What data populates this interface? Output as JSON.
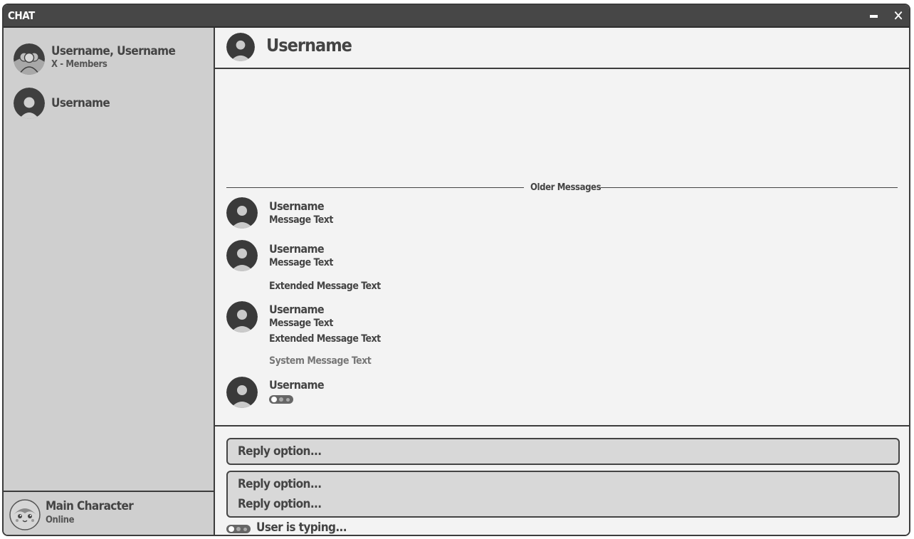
{
  "window": {
    "title": "CHAT",
    "minimize_icon": "minimize-icon",
    "close_icon": "close-icon",
    "close_glyph": "✕"
  },
  "sidebar": {
    "conversations": [
      {
        "name": "Username, Username",
        "subtitle": "X - Members",
        "icon": "group-avatar-icon"
      },
      {
        "name": "Username",
        "icon": "user-avatar-icon"
      }
    ],
    "current_user": {
      "name": "Main Character",
      "status": "Online",
      "icon": "character-avatar"
    }
  },
  "chat": {
    "header": {
      "name": "Username",
      "icon": "user-avatar-icon"
    },
    "divider_label": "Older Messages",
    "messages": [
      {
        "user": "Username",
        "lines": [
          "Message Text"
        ]
      },
      {
        "user": "Username",
        "lines": [
          "Message Text",
          "Extended Message Text"
        ]
      },
      {
        "user": "Username",
        "lines": [
          "Message Text",
          "Extended Message Text"
        ]
      },
      {
        "system": "System Message Text"
      },
      {
        "user": "Username",
        "typing": true,
        "icon": "typing-indicator-icon"
      }
    ],
    "reply_options": [
      "Reply option...",
      "Reply option...",
      "Reply option..."
    ],
    "typing_status": "User is typing...",
    "colors": {
      "titlebar": "#474747",
      "sidebar": "#cfcfcf",
      "content": "#f3f3f3",
      "reply_bg": "#d8d8d8",
      "border": "#3c3c3c"
    }
  }
}
